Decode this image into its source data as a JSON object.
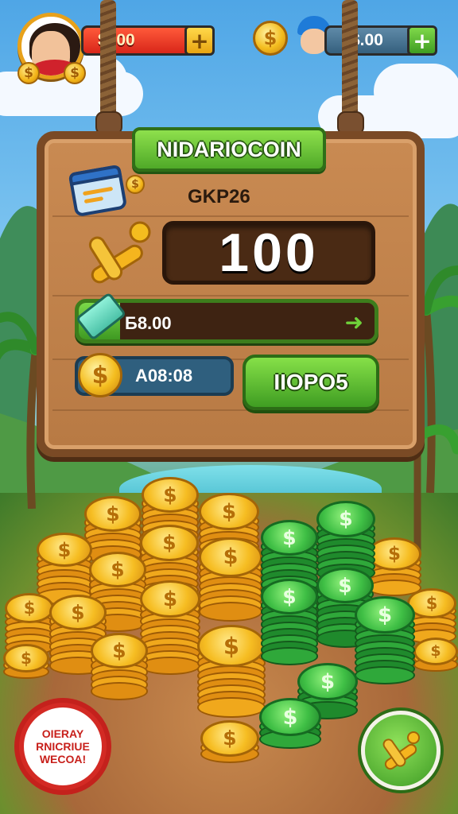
{
  "hud": {
    "player_balance": "$300",
    "opponent_balance": "$.00",
    "add_icon": "plus-icon"
  },
  "board": {
    "title": "NIDARIOCOIN",
    "subtitle": "GKP26",
    "big_number": "100",
    "progress": {
      "value_text": "Б8.00",
      "fill_fraction": 0.14
    },
    "coin_pill_text": "A08:08",
    "action_button_label": "IIOPO5"
  },
  "badge": {
    "text": "OIERAY\nRNICRIUE\nWECOA!"
  },
  "colors": {
    "accent_green": "#4fa928",
    "wood": "#b87a44",
    "coin_gold": "#f4bd1f",
    "badge_red": "#d32a24"
  }
}
